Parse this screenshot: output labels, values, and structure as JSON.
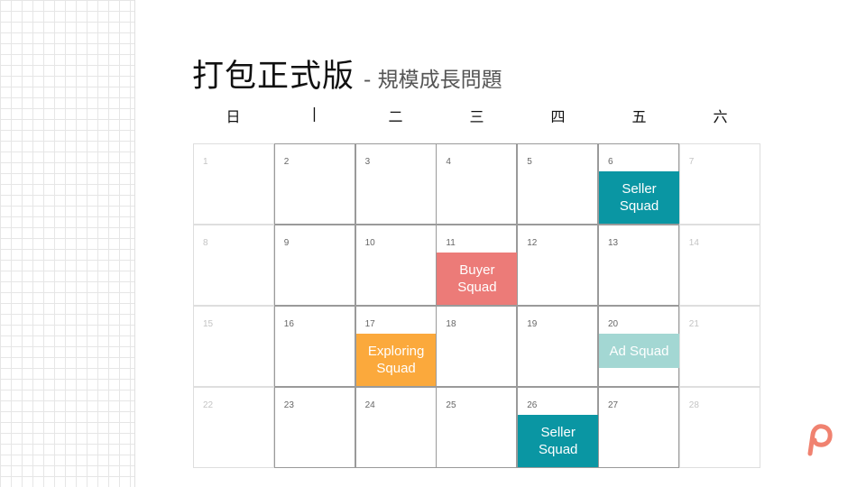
{
  "header": {
    "title": "打包正式版",
    "subtitle": "- 規模成長問題"
  },
  "weekdays": [
    "日",
    "|",
    "二",
    "三",
    "四",
    "五",
    "六"
  ],
  "calendar": {
    "weeks": [
      [
        1,
        2,
        3,
        4,
        5,
        6,
        7
      ],
      [
        8,
        9,
        10,
        11,
        12,
        13,
        14
      ],
      [
        15,
        16,
        17,
        18,
        19,
        20,
        21
      ],
      [
        22,
        23,
        24,
        25,
        26,
        27,
        28
      ]
    ],
    "events": [
      {
        "day": 6,
        "label": "Seller\nSquad",
        "color": "#0a96a3"
      },
      {
        "day": 11,
        "label": "Buyer\nSquad",
        "color": "#ec7b78"
      },
      {
        "day": 17,
        "label": "Exploring\nSquad",
        "color": "#fba93c"
      },
      {
        "day": 20,
        "label": "Ad Squad",
        "color": "#a3d7d3"
      },
      {
        "day": 26,
        "label": "Seller\nSquad",
        "color": "#0a96a3"
      }
    ]
  },
  "branding": {
    "logo_icon": "brand-logo-icon",
    "logo_color": "#f08270"
  }
}
